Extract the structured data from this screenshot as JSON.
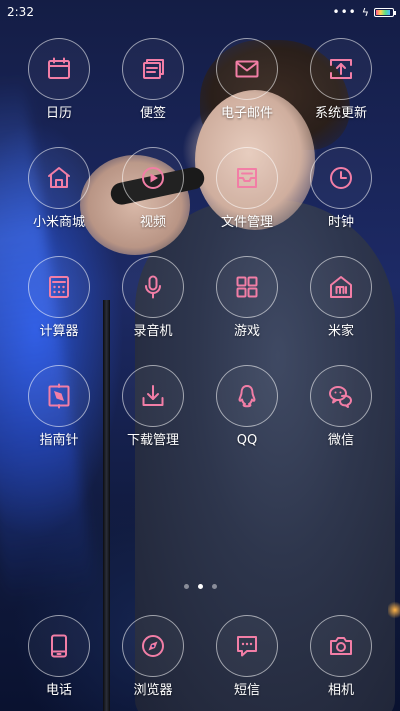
{
  "status_bar": {
    "time": "2:32",
    "signal_icon": "dots-icon",
    "charging_icon": "bolt-icon",
    "battery_icon": "battery-icon",
    "battery_level": 0.85
  },
  "colors": {
    "icon_accent": "#f27ea6",
    "ring": "#ffffff"
  },
  "apps": [
    {
      "label": "日历",
      "icon": "calendar-icon"
    },
    {
      "label": "便签",
      "icon": "notes-icon"
    },
    {
      "label": "电子邮件",
      "icon": "mail-icon"
    },
    {
      "label": "系统更新",
      "icon": "system-update-icon"
    },
    {
      "label": "小米商城",
      "icon": "store-icon"
    },
    {
      "label": "视频",
      "icon": "video-icon"
    },
    {
      "label": "文件管理",
      "icon": "file-manager-icon"
    },
    {
      "label": "时钟",
      "icon": "clock-icon"
    },
    {
      "label": "计算器",
      "icon": "calculator-icon"
    },
    {
      "label": "录音机",
      "icon": "microphone-icon"
    },
    {
      "label": "游戏",
      "icon": "games-icon"
    },
    {
      "label": "米家",
      "icon": "mi-home-icon"
    },
    {
      "label": "指南针",
      "icon": "compass-icon"
    },
    {
      "label": "下载管理",
      "icon": "download-icon"
    },
    {
      "label": "QQ",
      "icon": "qq-icon"
    },
    {
      "label": "微信",
      "icon": "wechat-icon"
    }
  ],
  "pager": {
    "page_count": 3,
    "active_page": 2
  },
  "dock": [
    {
      "label": "电话",
      "icon": "phone-icon"
    },
    {
      "label": "浏览器",
      "icon": "browser-icon"
    },
    {
      "label": "短信",
      "icon": "messages-icon"
    },
    {
      "label": "相机",
      "icon": "camera-icon"
    }
  ]
}
